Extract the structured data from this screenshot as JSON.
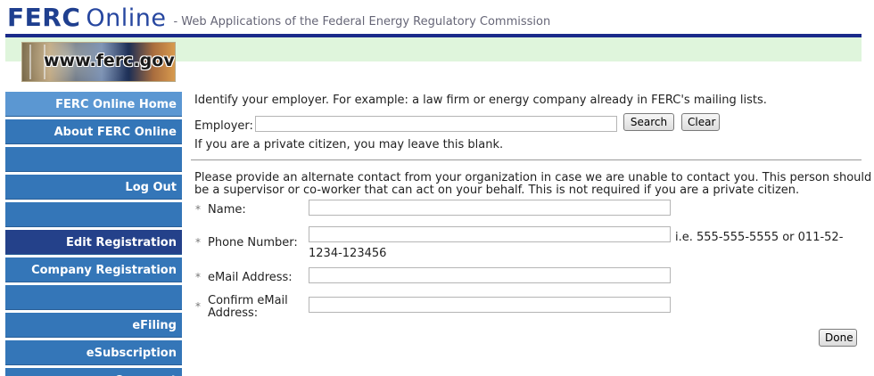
{
  "header": {
    "brand_main": "FERC",
    "brand_secondary": "Online",
    "tagline": "- Web Applications of the Federal Energy Regulatory Commission",
    "logo_text": "www.ferc.gov"
  },
  "colors": {
    "header_rule": "#1a2a8a",
    "header_band": "#dff5dc",
    "nav_bg": "#3476b8",
    "nav_light": "#5b97d2",
    "nav_active": "#24418a"
  },
  "sidebar": {
    "items": [
      {
        "label": "FERC Online Home"
      },
      {
        "label": "About FERC Online"
      },
      {
        "label": ""
      },
      {
        "label": "Log Out"
      },
      {
        "label": ""
      },
      {
        "label": "Edit Registration"
      },
      {
        "label": "Company Registration"
      },
      {
        "label": ""
      },
      {
        "label": "eFiling"
      },
      {
        "label": "eSubscription"
      },
      {
        "label": "eComment"
      }
    ]
  },
  "employer": {
    "instructions": "Identify your employer. For example: a law firm or energy company already in FERC's mailing lists.",
    "label": "Employer:",
    "value": "",
    "search_label": "Search",
    "clear_label": "Clear",
    "note": "If you are a private citizen, you may leave this blank."
  },
  "contact": {
    "instructions_line1": "Please provide an alternate contact from your organization in case we are unable to contact you. This person should",
    "instructions_line2": "be a supervisor or co-worker that can act on your behalf. This is not required if you are a private citizen.",
    "required_marker": "*",
    "name_label": "Name:",
    "name_value": "",
    "phone_label": "Phone Number:",
    "phone_value": "",
    "phone_hint_line1": "i.e. 555-555-5555 or 011-52-",
    "phone_hint_line2": "1234-123456",
    "email_label": "eMail Address:",
    "email_value": "",
    "confirm_email_label_line1": "Confirm eMail",
    "confirm_email_label_line2": "Address:",
    "confirm_email_value": "",
    "done_label": "Done"
  }
}
